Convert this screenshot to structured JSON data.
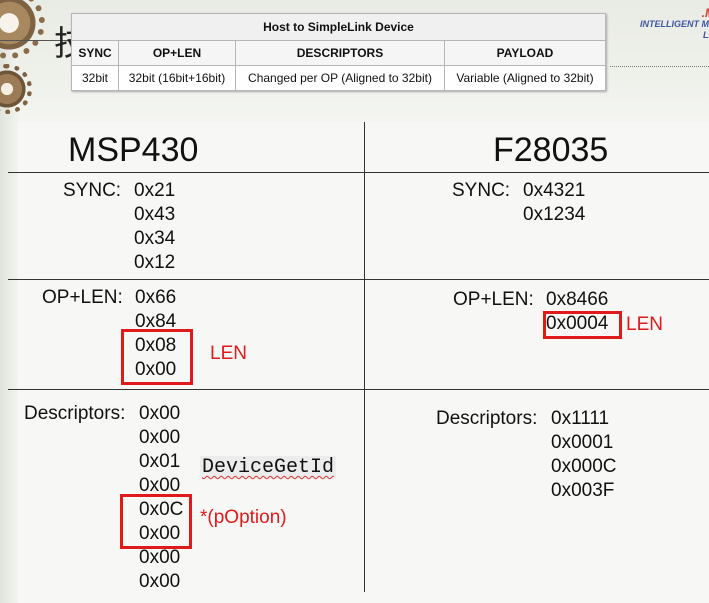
{
  "header": {
    "title_char": "技",
    "brand_line1": ".M",
    "brand_line2": "INTELLIGENT ME",
    "brand_line3": "LA",
    "table": {
      "caption": "Host to SimpleLink Device",
      "columns": [
        "SYNC",
        "OP+LEN",
        "DESCRIPTORS",
        "PAYLOAD"
      ],
      "row": [
        "32bit",
        "32bit (16bit+16bit)",
        "Changed per OP (Aligned to 32bit)",
        "Variable (Aligned to 32bit)"
      ]
    }
  },
  "compare": {
    "left_title": "MSP430",
    "right_title": "F28035",
    "msp430": {
      "sync_label": "SYNC:",
      "sync_values": [
        "0x21",
        "0x43",
        "0x34",
        "0x12"
      ],
      "oplen_label": "OP+LEN:",
      "oplen_values": [
        "0x66",
        "0x84",
        "0x08",
        "0x00"
      ],
      "len_note": "LEN",
      "desc_label": "Descriptors:",
      "desc_values": [
        "0x00",
        "0x00",
        "0x01",
        "0x00",
        "0x0C",
        "0x00",
        "0x00",
        "0x00"
      ],
      "api_name": "DeviceGetId",
      "option_note": "*(pOption)"
    },
    "f28035": {
      "sync_label": "SYNC:",
      "sync_values": [
        "0x4321",
        "0x1234"
      ],
      "oplen_label": "OP+LEN:",
      "oplen_values": [
        "0x8466",
        "0x0004"
      ],
      "len_note": "LEN",
      "desc_label": "Descriptors:",
      "desc_values": [
        "0x1111",
        "0x0001",
        "0x000C",
        "0x003F"
      ]
    }
  },
  "colors": {
    "highlight": "#e01a1a",
    "brand_blue": "#3f55a3"
  }
}
